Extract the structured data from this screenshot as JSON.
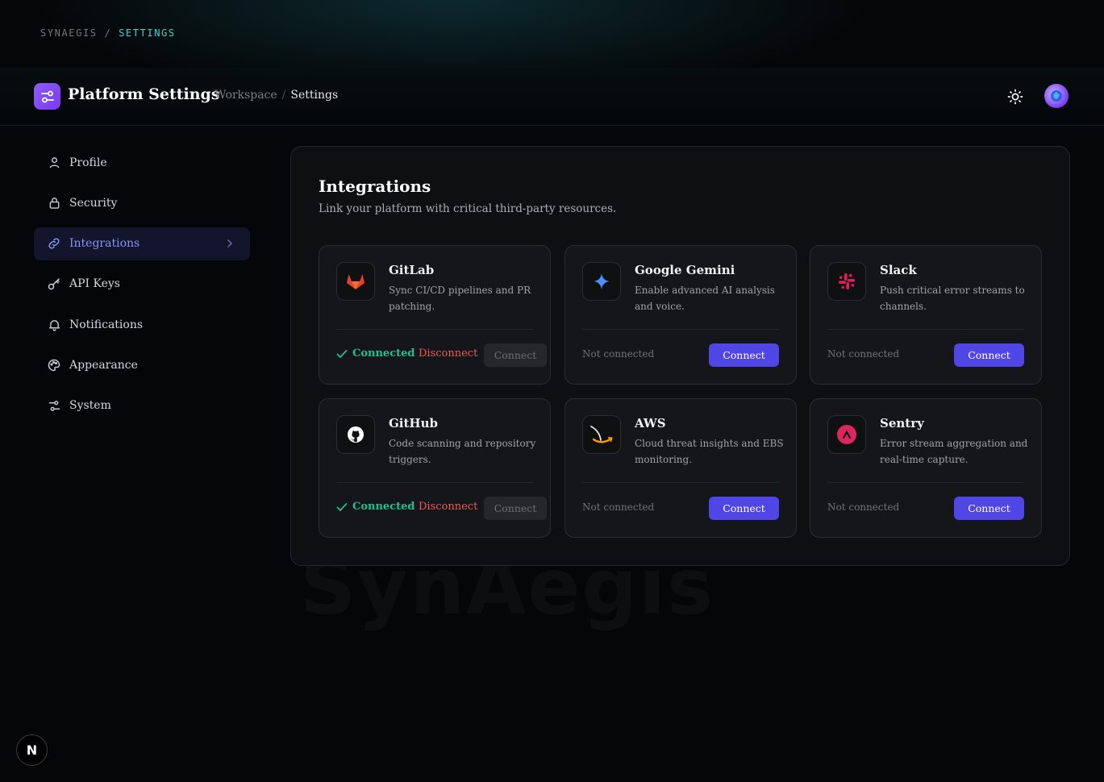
{
  "top_breadcrumb": {
    "root": "SYNAEGIS",
    "separator": "/",
    "current": "SETTINGS"
  },
  "header": {
    "title": "Platform Settings",
    "breadcrumb": {
      "parent": "Workspace",
      "separator": "/",
      "current": "Settings"
    }
  },
  "sidebar": {
    "items": [
      {
        "label": "Profile",
        "icon": "user-icon"
      },
      {
        "label": "Security",
        "icon": "lock-icon"
      },
      {
        "label": "Integrations",
        "icon": "link-icon",
        "active": true
      },
      {
        "label": "API Keys",
        "icon": "key-icon"
      },
      {
        "label": "Notifications",
        "icon": "bell-icon"
      },
      {
        "label": "Appearance",
        "icon": "palette-icon"
      },
      {
        "label": "System",
        "icon": "sliders-icon"
      }
    ]
  },
  "integrations": {
    "title": "Integrations",
    "subtitle": "Link your platform with critical third-party resources.",
    "connected_label": "Connected",
    "disconnect_label": "Disconnect",
    "not_connected_label": "Not connected",
    "connect_label": "Connect",
    "cards": [
      {
        "name": "GitLab",
        "description": "Sync CI/CD pipelines and PR patching.",
        "connected": true,
        "icon": "gitlab-icon"
      },
      {
        "name": "Google Gemini",
        "description": "Enable advanced AI analysis and voice.",
        "connected": false,
        "icon": "gemini-icon"
      },
      {
        "name": "Slack",
        "description": "Push critical error streams to channels.",
        "connected": false,
        "icon": "slack-icon"
      },
      {
        "name": "GitHub",
        "description": "Code scanning and repository triggers.",
        "connected": true,
        "icon": "github-icon"
      },
      {
        "name": "AWS",
        "description": "Cloud threat insights and EBS monitoring.",
        "connected": false,
        "icon": "aws-icon"
      },
      {
        "name": "Sentry",
        "description": "Error stream aggregation and real-time capture.",
        "connected": false,
        "icon": "sentry-icon"
      }
    ]
  },
  "colors": {
    "accent": "#4f46e5",
    "success": "#22c08a",
    "danger": "#ef5a5a",
    "brand": "#8b5cf6"
  }
}
